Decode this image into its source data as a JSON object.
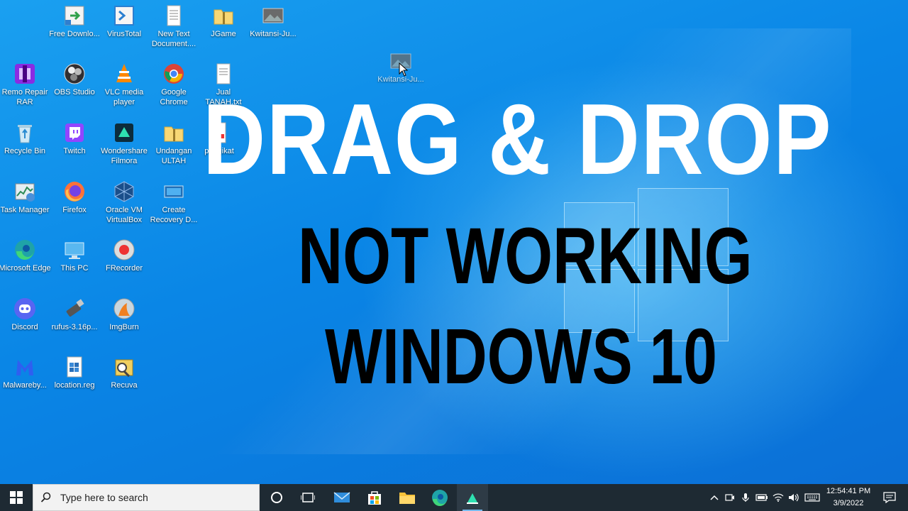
{
  "desktop": {
    "icons": [
      {
        "label": "Free Downlo...",
        "icon": "free-download-manager-icon"
      },
      {
        "label": "VirusTotal",
        "icon": "virustotal-icon"
      },
      {
        "label": "New Text Document....",
        "icon": "text-document-icon"
      },
      {
        "label": "JGame",
        "icon": "folder-zip-icon"
      },
      {
        "label": "Kwitansi-Ju...",
        "icon": "image-file-icon"
      },
      {
        "label": "Remo Repair RAR",
        "icon": "remo-repair-icon"
      },
      {
        "label": "OBS Studio",
        "icon": "obs-studio-icon"
      },
      {
        "label": "VLC media player",
        "icon": "vlc-icon"
      },
      {
        "label": "Google Chrome",
        "icon": "chrome-icon"
      },
      {
        "label": "Jual TANAH.txt",
        "icon": "text-document-icon"
      },
      {
        "label": "Recycle Bin",
        "icon": "recycle-bin-icon"
      },
      {
        "label": "Twitch",
        "icon": "twitch-icon"
      },
      {
        "label": "Wondershare Filmora",
        "icon": "filmora-icon"
      },
      {
        "label": "Undangan ULTAH",
        "icon": "folder-zip-icon"
      },
      {
        "label": "pengikat",
        "icon": "pdf-file-icon"
      },
      {
        "label": "Task Manager",
        "icon": "task-manager-icon"
      },
      {
        "label": "Firefox",
        "icon": "firefox-icon"
      },
      {
        "label": "Oracle VM VirtualBox",
        "icon": "virtualbox-icon"
      },
      {
        "label": "Create Recovery D...",
        "icon": "recovery-drive-icon"
      },
      {
        "label": "Microsoft Edge",
        "icon": "edge-icon"
      },
      {
        "label": "This PC",
        "icon": "this-pc-icon"
      },
      {
        "label": "FRecorder",
        "icon": "frecorder-icon"
      },
      {
        "label": "Discord",
        "icon": "discord-icon"
      },
      {
        "label": "rufus-3.16p...",
        "icon": "rufus-icon"
      },
      {
        "label": "ImgBurn",
        "icon": "imgburn-icon"
      },
      {
        "label": "Malwareby...",
        "icon": "malwarebytes-icon"
      },
      {
        "label": "location.reg",
        "icon": "registry-file-icon"
      },
      {
        "label": "Recuva",
        "icon": "recuva-icon"
      }
    ],
    "dragging_icon": {
      "label": "Kwitansi-Ju...",
      "icon": "image-file-icon"
    },
    "headline": {
      "line1": "DRAG & DROP",
      "line2": "NOT WORKING",
      "line3": "WINDOWS 10"
    }
  },
  "taskbar": {
    "search_placeholder": "Type here to search",
    "apps": [
      "cortana-icon",
      "task-view-icon",
      "mail-icon",
      "store-icon",
      "file-explorer-icon",
      "edge-icon",
      "filmora-icon"
    ],
    "clock": {
      "time": "12:54:41 PM",
      "date": "3/9/2022"
    },
    "colors": {
      "taskbar": "#1e2a33",
      "desktop": "#0a86e6",
      "accent": "#76b9ed"
    }
  }
}
